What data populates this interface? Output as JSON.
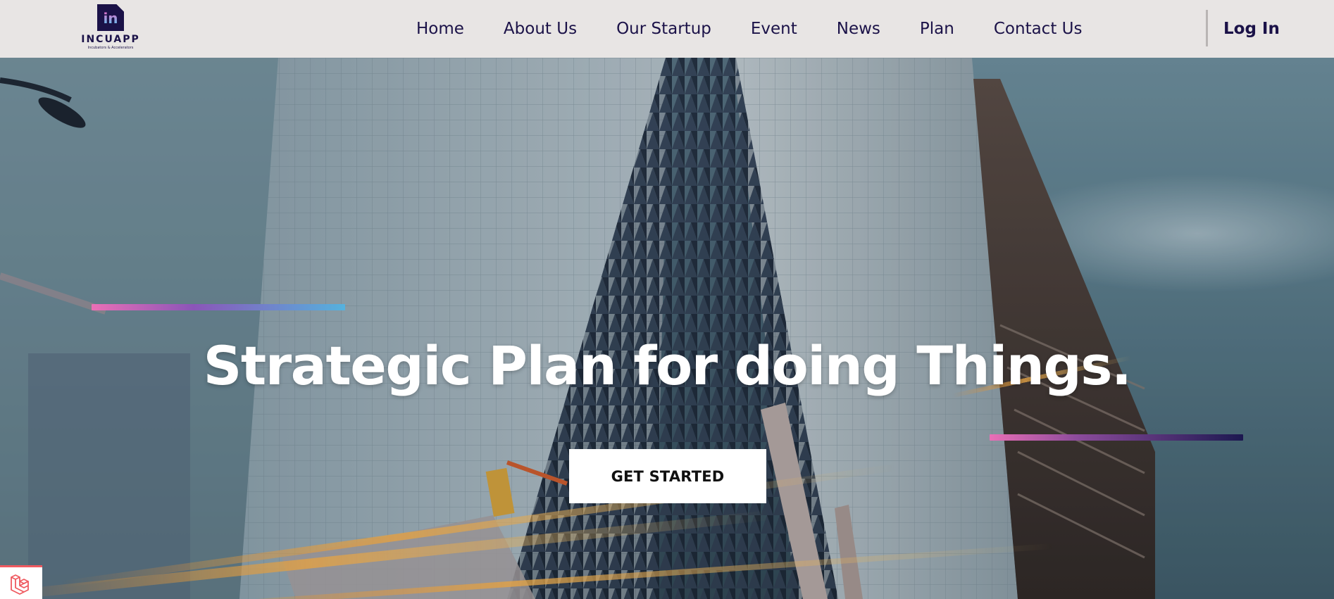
{
  "brand": {
    "mark": "in",
    "name": "INCUAPP",
    "tagline": "Incubators & Accelerators"
  },
  "nav": {
    "items": [
      {
        "label": "Home"
      },
      {
        "label": "About Us"
      },
      {
        "label": "Our Startup"
      },
      {
        "label": "Event"
      },
      {
        "label": "News"
      },
      {
        "label": "Plan"
      },
      {
        "label": "Contact Us"
      }
    ],
    "login_label": "Log In"
  },
  "hero": {
    "title": "Strategic Plan for doing Things.",
    "cta_label": "GET STARTED"
  },
  "icons": {
    "logo": "incuapp-logo-icon",
    "corner": "laravel-icon"
  },
  "colors": {
    "navbar_bg": "#e8e5e4",
    "nav_text": "#1b1248",
    "hero_text": "#ffffff",
    "cta_bg": "#ffffff",
    "accent_pink": "#ea6fb6",
    "accent_blue": "#55b2de",
    "accent_navy": "#1c1850"
  }
}
